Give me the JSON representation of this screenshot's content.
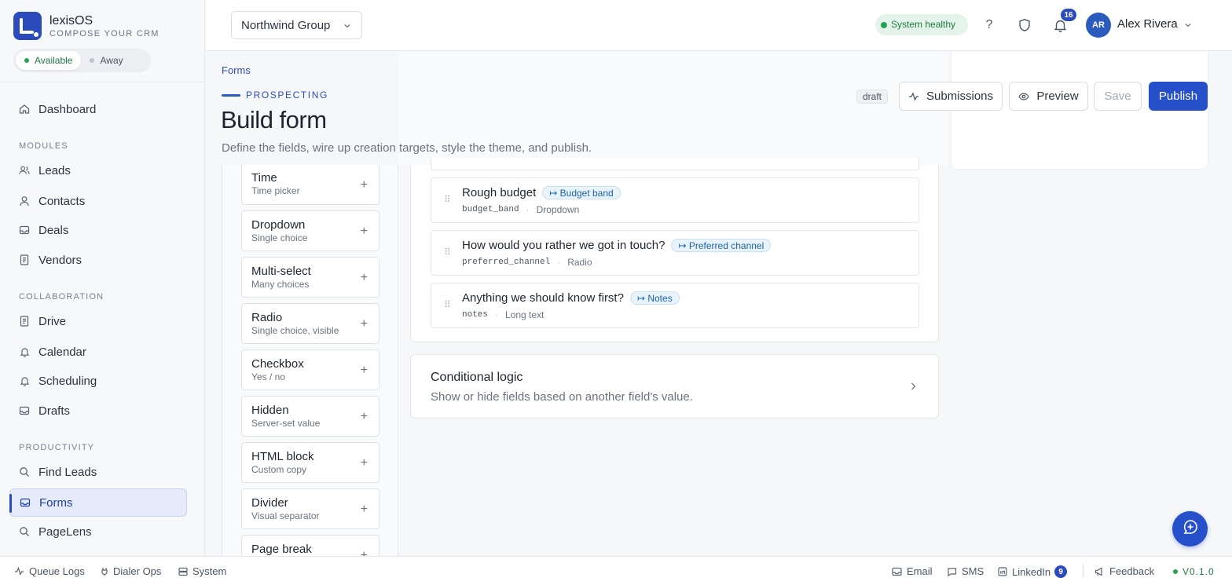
{
  "brand": {
    "name": "lexisOS",
    "tagline": "COMPOSE YOUR CRM"
  },
  "presence": {
    "options": [
      "Available",
      "Away"
    ],
    "selected": "Available",
    "colors": {
      "Available": "#22a356",
      "Away": "#9ca3af"
    }
  },
  "sidebar": {
    "dashboard": {
      "label": "Dashboard",
      "icon": "home-icon"
    },
    "sections": [
      {
        "title": "MODULES",
        "items": [
          {
            "label": "Leads",
            "icon": "users-icon"
          },
          {
            "label": "Contacts",
            "icon": "user-icon"
          },
          {
            "label": "Deals",
            "icon": "inbox-icon"
          },
          {
            "label": "Vendors",
            "icon": "document-icon"
          }
        ]
      },
      {
        "title": "COLLABORATION",
        "items": [
          {
            "label": "Drive",
            "icon": "document-icon"
          },
          {
            "label": "Calendar",
            "icon": "bell-icon"
          },
          {
            "label": "Scheduling",
            "icon": "bell-icon"
          },
          {
            "label": "Drafts",
            "icon": "inbox-icon"
          }
        ]
      },
      {
        "title": "PRODUCTIVITY",
        "items": [
          {
            "label": "Find Leads",
            "icon": "search-icon"
          },
          {
            "label": "Forms",
            "icon": "inbox-icon",
            "active": true
          },
          {
            "label": "PageLens",
            "icon": "search-icon"
          }
        ]
      }
    ]
  },
  "topbar": {
    "org": "Northwind Group",
    "health": "System healthy",
    "notifications_count": "16",
    "user": {
      "initials": "AR",
      "name": "Alex Rivera"
    }
  },
  "page": {
    "breadcrumb": "Forms",
    "eyebrow": "PROSPECTING",
    "title": "Build form",
    "subtitle": "Define the fields, wire up creation targets, style the theme, and publish.",
    "status": "draft",
    "actions": {
      "submissions": "Submissions",
      "preview": "Preview",
      "save": "Save",
      "publish": "Publish"
    }
  },
  "palette": [
    {
      "name": "Time",
      "desc": "Time picker"
    },
    {
      "name": "Dropdown",
      "desc": "Single choice"
    },
    {
      "name": "Multi-select",
      "desc": "Many choices"
    },
    {
      "name": "Radio",
      "desc": "Single choice, visible"
    },
    {
      "name": "Checkbox",
      "desc": "Yes / no"
    },
    {
      "name": "Hidden",
      "desc": "Server-set value"
    },
    {
      "name": "HTML block",
      "desc": "Custom copy"
    },
    {
      "name": "Divider",
      "desc": "Visual separator"
    },
    {
      "name": "Page break",
      "desc": ""
    }
  ],
  "fields": [
    {
      "label": "Rough budget",
      "mapping": "↦ Budget band",
      "key": "budget_band",
      "type": "Dropdown"
    },
    {
      "label": "How would you rather we got in touch?",
      "mapping": "↦ Preferred channel",
      "key": "preferred_channel",
      "type": "Radio"
    },
    {
      "label": "Anything we should know first?",
      "mapping": "↦ Notes",
      "key": "notes",
      "type": "Long text"
    }
  ],
  "logic": {
    "title": "Conditional logic",
    "subtitle": "Show or hide fields based on another field's value."
  },
  "bottombar": {
    "left": [
      "Queue Logs",
      "Dialer Ops",
      "System"
    ],
    "right": [
      "Email",
      "SMS",
      "LinkedIn",
      "Feedback"
    ],
    "linkedin_count": "9",
    "version": "V0.1.0"
  },
  "colors": {
    "accent": "#2650c9",
    "success": "#22a356",
    "chip": "#1c63a8"
  }
}
